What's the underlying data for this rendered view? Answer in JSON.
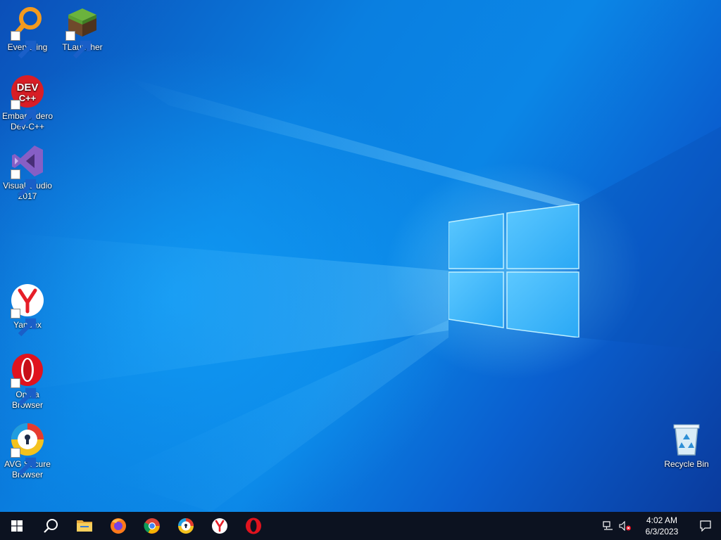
{
  "desktop": {
    "icons": [
      {
        "id": "everything",
        "label": "Everything",
        "icon": "magnifier-icon"
      },
      {
        "id": "tlauncher",
        "label": "TLauncher",
        "icon": "grass-block-icon"
      },
      {
        "id": "devcpp",
        "label": "Embarcadero Dev-C++",
        "icon_text": "DEV C++"
      },
      {
        "id": "visual-studio",
        "label": "Visual Studio 2017",
        "icon": "visual-studio-icon"
      },
      {
        "id": "yandex",
        "label": "Yandex",
        "icon": "yandex-icon"
      },
      {
        "id": "opera",
        "label": "Opera Browser",
        "icon": "opera-icon"
      },
      {
        "id": "avg",
        "label": "AVG Secure Browser",
        "icon": "avg-icon"
      },
      {
        "id": "recycle-bin",
        "label": "Recycle Bin",
        "icon": "recycle-bin-icon"
      }
    ]
  },
  "taskbar": {
    "items": [
      "start-icon",
      "search-icon",
      "file-explorer-icon",
      "firefox-icon",
      "chrome-icon",
      "avg-browser-icon",
      "yandex-icon",
      "opera-icon"
    ],
    "tray": [
      "network-icon",
      "volume-muted-icon"
    ],
    "clock": {
      "time": "4:02 AM",
      "date": "6/3/2023"
    }
  },
  "colors": {
    "taskbar": "#0c1220",
    "accent": "#0a78d7"
  }
}
